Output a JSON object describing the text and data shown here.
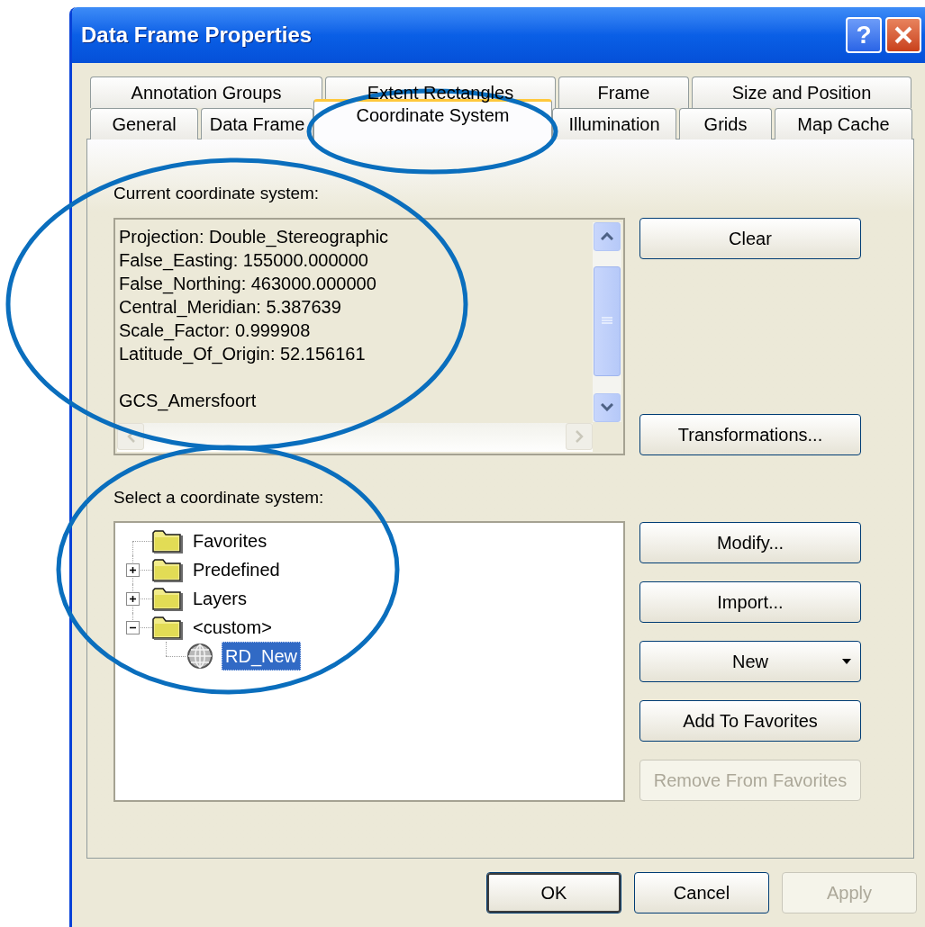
{
  "window": {
    "title": "Data Frame Properties"
  },
  "title_buttons": [
    {
      "kind": "help",
      "label": "?"
    },
    {
      "kind": "close"
    }
  ],
  "tab_rows": [
    [
      {
        "label": "Annotation Groups",
        "selected": false
      },
      {
        "label": "Extent Rectangles",
        "selected": false
      },
      {
        "label": "Frame",
        "selected": false
      },
      {
        "label": "Size and Position",
        "selected": false
      }
    ],
    [
      {
        "label": "General",
        "selected": false
      },
      {
        "label": "Data Frame",
        "selected": false
      },
      {
        "label": "Coordinate System",
        "selected": true
      },
      {
        "label": "Illumination",
        "selected": false
      },
      {
        "label": "Grids",
        "selected": false
      },
      {
        "label": "Map Cache",
        "selected": false
      }
    ]
  ],
  "current_coordinate_system": {
    "label": "Current coordinate system:",
    "projection_lines": [
      "Projection: Double_Stereographic",
      "False_Easting: 155000.000000",
      "False_Northing: 463000.000000",
      "Central_Meridian: 5.387639",
      "Scale_Factor: 0.999908",
      "Latitude_Of_Origin: 52.156161"
    ],
    "geographic_lines": [
      "GCS_Amersfoort"
    ]
  },
  "current_buttons": [
    {
      "label": "Clear",
      "disabled": false
    },
    {
      "label": "Transformations...",
      "disabled": false
    }
  ],
  "select_coordinate_system": {
    "label": "Select a coordinate system:",
    "tree": [
      {
        "label": "Favorites",
        "kind": "folder",
        "selected": false
      },
      {
        "label": "Predefined",
        "kind": "folder",
        "selected": false,
        "expanded": false
      },
      {
        "label": "Layers",
        "kind": "folder",
        "selected": false,
        "expanded": false
      },
      {
        "label": "<custom>",
        "kind": "folder",
        "selected": false,
        "expanded": true,
        "children": [
          {
            "label": "RD_New",
            "kind": "coordinate_system",
            "selected": true
          }
        ]
      }
    ]
  },
  "select_buttons": [
    {
      "label": "Modify...",
      "disabled": false
    },
    {
      "label": "Import...",
      "disabled": false
    },
    {
      "label": "New",
      "disabled": false,
      "kind": "dropdown"
    },
    {
      "label": "Add To Favorites",
      "disabled": false
    },
    {
      "label": "Remove From Favorites",
      "disabled": true
    }
  ],
  "dialog_buttons": [
    {
      "label": "OK",
      "disabled": false,
      "default": true
    },
    {
      "label": "Cancel",
      "disabled": false,
      "default": false
    },
    {
      "label": "Apply",
      "disabled": true,
      "default": false
    }
  ],
  "highlight_ellipses": [
    {
      "kind": "ellipse"
    },
    {
      "kind": "ellipse"
    },
    {
      "kind": "ellipse"
    }
  ]
}
